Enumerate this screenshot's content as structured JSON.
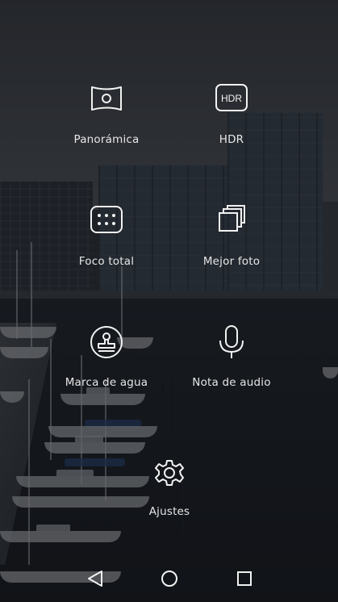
{
  "modes": {
    "panorama": {
      "label": "Panorámica",
      "icon": "panorama-icon"
    },
    "hdr": {
      "label": "HDR",
      "icon": "hdr-icon",
      "icon_text": "HDR"
    },
    "all_focus": {
      "label": "Foco total",
      "icon": "all-focus-icon"
    },
    "best_photo": {
      "label": "Mejor foto",
      "icon": "best-photo-icon"
    },
    "watermark": {
      "label": "Marca de agua",
      "icon": "watermark-stamp-icon"
    },
    "audio_note": {
      "label": "Nota de audio",
      "icon": "microphone-icon"
    },
    "settings": {
      "label": "Ajustes",
      "icon": "gear-icon"
    }
  },
  "navbar": {
    "back": {
      "icon": "back-triangle-icon"
    },
    "home": {
      "icon": "home-circle-icon"
    },
    "recents": {
      "icon": "recents-square-icon"
    }
  },
  "colors": {
    "icon_stroke": "#f2f2f2",
    "label_text": "#e6e6e6",
    "overlay": "#121418"
  }
}
